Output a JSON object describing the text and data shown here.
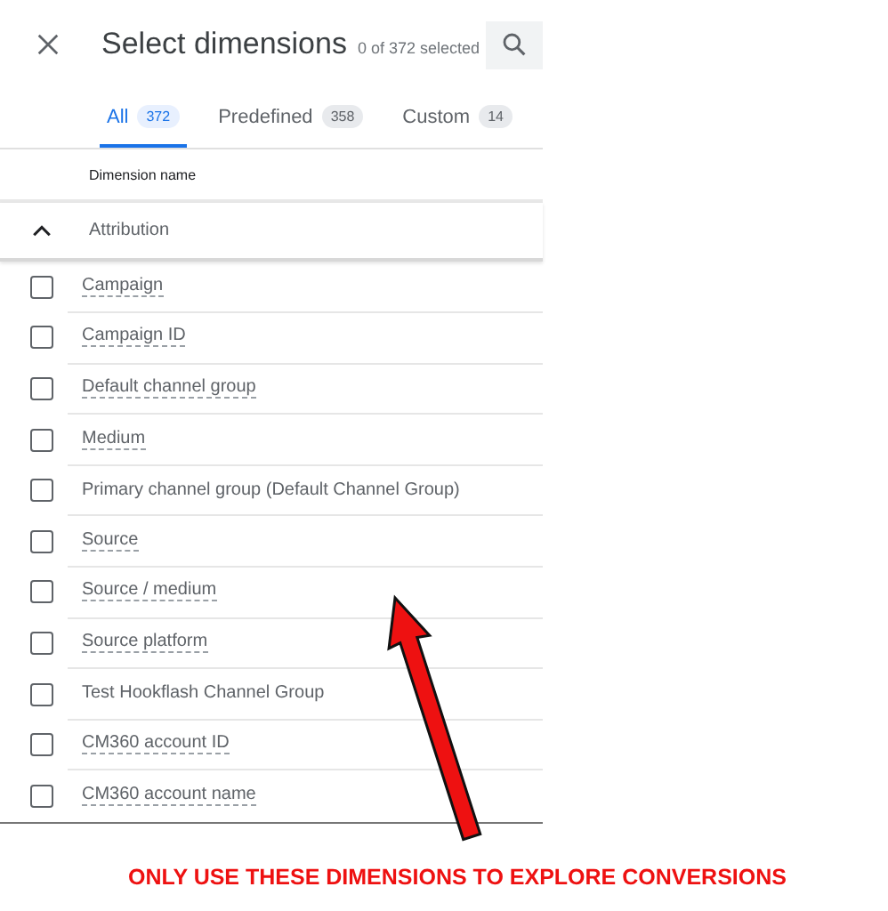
{
  "dialog": {
    "title": "Select dimensions",
    "selection_count": "0 of 372 selected"
  },
  "tabs": [
    {
      "label": "All",
      "count": "372",
      "selected": true
    },
    {
      "label": "Predefined",
      "count": "358",
      "selected": false
    },
    {
      "label": "Custom",
      "count": "14",
      "selected": false
    }
  ],
  "table": {
    "column_header": "Dimension name"
  },
  "group": {
    "label": "Attribution",
    "expanded": true,
    "rows": [
      {
        "name": "Campaign",
        "checked": false,
        "underlined": true
      },
      {
        "name": "Campaign ID",
        "checked": false,
        "underlined": true
      },
      {
        "name": "Default channel group",
        "checked": false,
        "underlined": true
      },
      {
        "name": "Medium",
        "checked": false,
        "underlined": true
      },
      {
        "name": "Primary channel group (Default Channel Group)",
        "checked": false,
        "underlined": false
      },
      {
        "name": "Source",
        "checked": false,
        "underlined": true
      },
      {
        "name": "Source / medium",
        "checked": false,
        "underlined": true
      },
      {
        "name": "Source platform",
        "checked": false,
        "underlined": true
      },
      {
        "name": "Test Hookflash Channel Group",
        "checked": false,
        "underlined": false
      },
      {
        "name": "CM360 account ID",
        "checked": false,
        "underlined": true
      },
      {
        "name": "CM360 account name",
        "checked": false,
        "underlined": true
      }
    ]
  },
  "annotation": {
    "caption": "ONLY USE THESE DIMENSIONS TO EXPLORE CONVERSIONS"
  }
}
